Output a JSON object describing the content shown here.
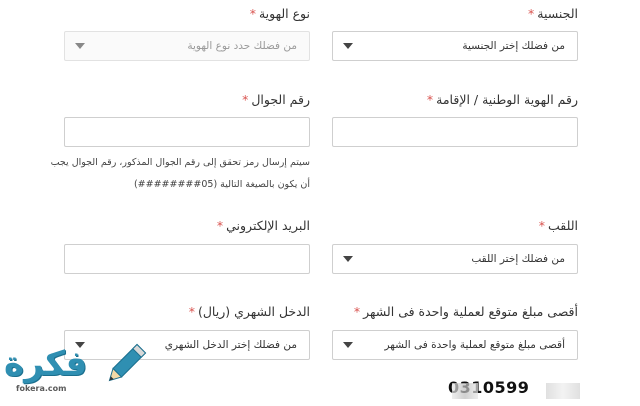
{
  "form": {
    "nationality": {
      "label": "الجنسية",
      "required": "*",
      "value": "من فضلك إختر الجنسية"
    },
    "id_type": {
      "label": "نوع الهوية",
      "required": "*",
      "placeholder": "من فضلك حدد نوع الهوية"
    },
    "national_id": {
      "label": "رقم الهوية الوطنية / الإقامة",
      "required": "*",
      "value": ""
    },
    "mobile": {
      "label": "رقم الجوال",
      "required": "*",
      "value": "",
      "hint_line1": "سيتم إرسال رمز تحقق إلى رقم الجوال المذكور، رقم الجوال يجب",
      "hint_line2": "أن يكون بالصيغة التالية  (05########)"
    },
    "title": {
      "label": "اللقب",
      "required": "*",
      "value": "من فضلك إختر اللقب"
    },
    "email": {
      "label": "البريد الإلكتروني",
      "required": "*",
      "value": ""
    },
    "max_amount": {
      "label": "أقصى مبلغ متوقع لعملية واحدة فى الشهر",
      "required": "*",
      "value": "أقصى مبلغ متوقع لعملية واحدة فى الشهر"
    },
    "monthly_income": {
      "label": "الدخل الشهري (ريال)",
      "required": "*",
      "value": "من فضلك إختر الدخل الشهري"
    }
  },
  "partial_phone_text": "0310599",
  "watermark": {
    "name": "فكرة",
    "domain": "fokera.com",
    "icon": "pencil-icon"
  },
  "colors": {
    "required": "#d9534f",
    "border": "#cfcfcf",
    "brand": "#2f8fb2"
  }
}
